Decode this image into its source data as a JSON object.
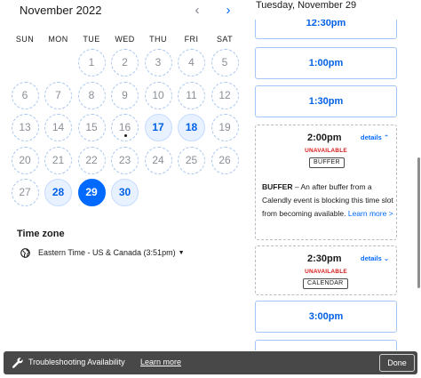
{
  "calendar": {
    "month_title": "November 2022",
    "prev_icon": "chevron-left-icon",
    "next_icon": "chevron-right-icon",
    "weekdays": [
      "SUN",
      "MON",
      "TUE",
      "WED",
      "THU",
      "FRI",
      "SAT"
    ],
    "first_weekday_index": 2,
    "days": [
      {
        "n": "1",
        "state": "disabled"
      },
      {
        "n": "2",
        "state": "disabled"
      },
      {
        "n": "3",
        "state": "disabled"
      },
      {
        "n": "4",
        "state": "disabled"
      },
      {
        "n": "5",
        "state": "disabled"
      },
      {
        "n": "6",
        "state": "disabled"
      },
      {
        "n": "7",
        "state": "disabled"
      },
      {
        "n": "8",
        "state": "disabled"
      },
      {
        "n": "9",
        "state": "disabled"
      },
      {
        "n": "10",
        "state": "disabled"
      },
      {
        "n": "11",
        "state": "disabled"
      },
      {
        "n": "12",
        "state": "disabled"
      },
      {
        "n": "13",
        "state": "disabled"
      },
      {
        "n": "14",
        "state": "disabled"
      },
      {
        "n": "15",
        "state": "disabled"
      },
      {
        "n": "16",
        "state": "disabled",
        "today": true
      },
      {
        "n": "17",
        "state": "available"
      },
      {
        "n": "18",
        "state": "available"
      },
      {
        "n": "19",
        "state": "disabled"
      },
      {
        "n": "20",
        "state": "disabled"
      },
      {
        "n": "21",
        "state": "disabled"
      },
      {
        "n": "22",
        "state": "disabled"
      },
      {
        "n": "23",
        "state": "disabled"
      },
      {
        "n": "24",
        "state": "disabled"
      },
      {
        "n": "25",
        "state": "disabled"
      },
      {
        "n": "26",
        "state": "disabled"
      },
      {
        "n": "27",
        "state": "disabled"
      },
      {
        "n": "28",
        "state": "available"
      },
      {
        "n": "29",
        "state": "selected"
      },
      {
        "n": "30",
        "state": "available"
      }
    ]
  },
  "timezone": {
    "title": "Time zone",
    "icon": "globe-icon",
    "value": "Eastern Time - US & Canada (3:51pm)"
  },
  "slots": {
    "day_title": "Tuesday, November 29",
    "top_slot": "12:30pm",
    "slot_1": "1:00pm",
    "slot_2": "1:30pm",
    "slot_3": "3:00pm",
    "busy_1": {
      "time": "2:00pm",
      "details": "details",
      "details_icon": "chevron-up-icon",
      "status": "UNAVAILABLE",
      "tag": "BUFFER",
      "desc_bold": "BUFFER",
      "desc_text": " – An after buffer from a Calendly event is blocking this time slot from becoming available. ",
      "desc_link": "Learn more >"
    },
    "busy_2": {
      "time": "2:30pm",
      "details": "details",
      "details_icon": "chevron-down-icon",
      "status": "UNAVAILABLE",
      "tag": "CALENDAR"
    }
  },
  "banner": {
    "icon": "wrench-icon",
    "text": "Troubleshooting Availability",
    "link": "Learn more",
    "done_label": "Done"
  },
  "colors": {
    "accent": "#0069ff",
    "available_bg": "#e8f1ff",
    "unavailable_text": "#d81b1b",
    "banner_bg": "#484848"
  }
}
